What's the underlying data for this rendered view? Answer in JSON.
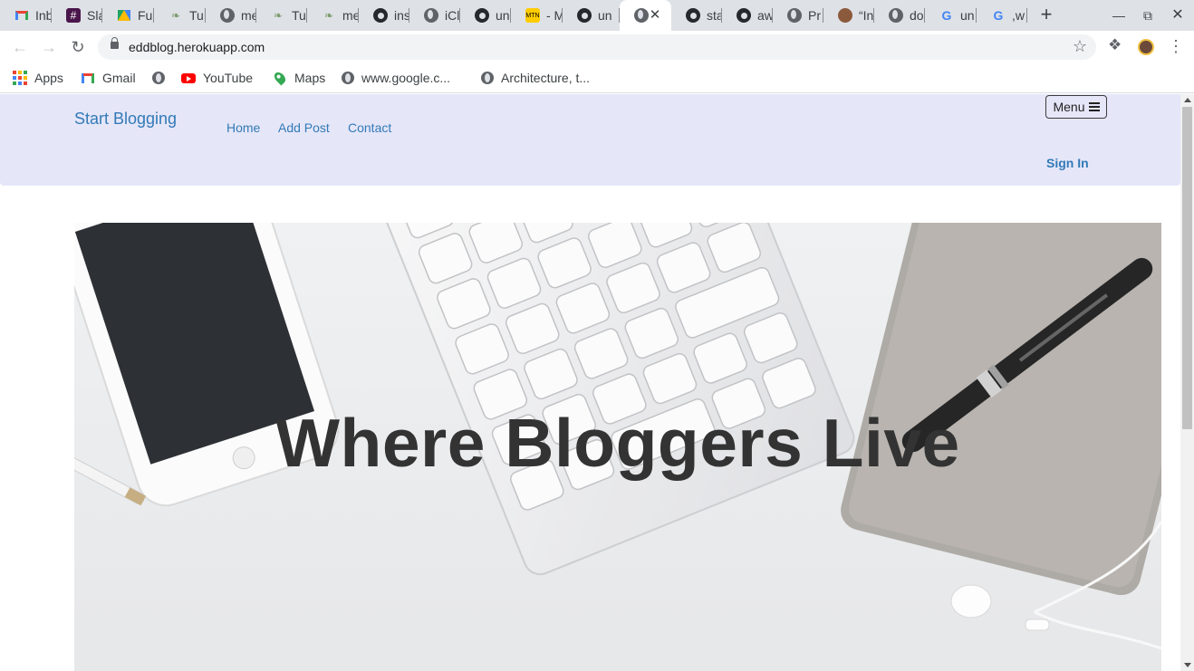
{
  "browser": {
    "tabs": [
      {
        "title": "Inb",
        "icon": "gmail-icon"
      },
      {
        "title": "Sla",
        "icon": "slack-icon"
      },
      {
        "title": "Fu",
        "icon": "google-drive-icon"
      },
      {
        "title": "Tu",
        "icon": "tree-icon"
      },
      {
        "title": "me",
        "icon": "globe-icon"
      },
      {
        "title": "Tu",
        "icon": "tree-icon"
      },
      {
        "title": "me",
        "icon": "tree-icon"
      },
      {
        "title": "ins",
        "icon": "github-icon"
      },
      {
        "title": "iCl",
        "icon": "globe-icon"
      },
      {
        "title": "un",
        "icon": "github-icon"
      },
      {
        "title": "- M",
        "icon": "mtn-icon"
      },
      {
        "title": "un",
        "icon": "github-icon"
      },
      {
        "title": "",
        "icon": "globe-icon",
        "active": true
      },
      {
        "title": "sta",
        "icon": "github-icon"
      },
      {
        "title": "aw",
        "icon": "github-icon"
      },
      {
        "title": "Pr",
        "icon": "globe-icon"
      },
      {
        "title": "“In",
        "icon": "avatar-icon"
      },
      {
        "title": "do",
        "icon": "globe-icon"
      },
      {
        "title": "un",
        "icon": "google-icon"
      },
      {
        "title": ",w",
        "icon": "google-icon"
      }
    ],
    "url": "eddblog.herokuapp.com",
    "bookmarks": [
      {
        "label": "Apps",
        "icon": "apps-grid-icon"
      },
      {
        "label": "Gmail",
        "icon": "gmail-icon"
      },
      {
        "label": "",
        "icon": "globe-icon"
      },
      {
        "label": "YouTube",
        "icon": "youtube-icon"
      },
      {
        "label": "Maps",
        "icon": "maps-icon"
      },
      {
        "label": "www.google.c...",
        "icon": "globe-icon"
      },
      {
        "label": "Architecture, t...",
        "icon": "globe-icon"
      }
    ]
  },
  "site": {
    "brand": "Start Blogging",
    "nav": [
      "Home",
      "Add Post",
      "Contact"
    ],
    "menu_label": "Menu",
    "signin_label": "Sign In",
    "hero_title": "Where Bloggers Live",
    "colors": {
      "navbar_bg": "#e5e6f8",
      "link": "#337ab7",
      "hero_text": "#333333"
    }
  }
}
